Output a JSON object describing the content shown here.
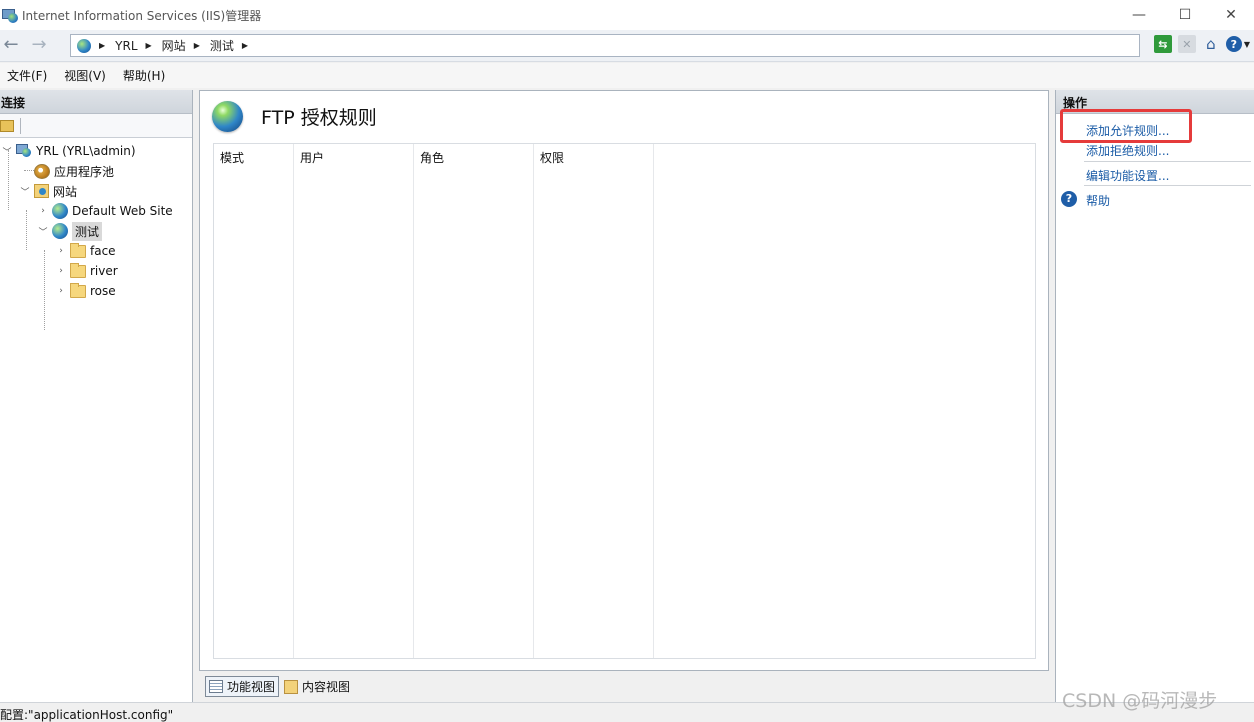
{
  "window": {
    "title": "Internet Information Services (IIS)管理器",
    "controls": {
      "minimize": "—",
      "maximize": "☐",
      "close": "✕"
    }
  },
  "address_bar": {
    "back": "←",
    "forward": "→",
    "breadcrumb": [
      "YRL",
      "网站",
      "测试"
    ],
    "sep": "▶"
  },
  "toolbar_icons": [
    "refresh-icon",
    "stop-icon",
    "home-icon",
    "help-icon"
  ],
  "menu": [
    "文件(F)",
    "视图(V)",
    "帮助(H)"
  ],
  "connections": {
    "header": "连接",
    "tree": [
      {
        "label": "YRL (YRL\\admin)",
        "icon": "server-icon",
        "expanded": true
      },
      {
        "label": "应用程序池",
        "icon": "app-pool-icon"
      },
      {
        "label": "网站",
        "icon": "sites-icon",
        "expanded": true
      },
      {
        "label": "Default Web Site",
        "icon": "globe-icon",
        "expanded": false
      },
      {
        "label": "测试",
        "icon": "globe-icon",
        "expanded": true,
        "selected": true
      },
      {
        "label": "face",
        "icon": "folder-icon"
      },
      {
        "label": "river",
        "icon": "folder-icon"
      },
      {
        "label": "rose",
        "icon": "folder-icon"
      }
    ]
  },
  "feature": {
    "title": "FTP 授权规则",
    "columns": [
      "模式",
      "用户",
      "角色",
      "权限"
    ]
  },
  "views": {
    "features": "功能视图",
    "content": "内容视图"
  },
  "actions": {
    "header": "操作",
    "items": [
      "添加允许规则...",
      "添加拒绝规则...",
      "编辑功能设置...",
      "帮助"
    ]
  },
  "status": {
    "text": "配置:\"applicationHost.config\""
  },
  "watermark": "CSDN @码河漫步",
  "colors": {
    "highlight": "#e53b3b",
    "link": "#1a5ba6"
  }
}
